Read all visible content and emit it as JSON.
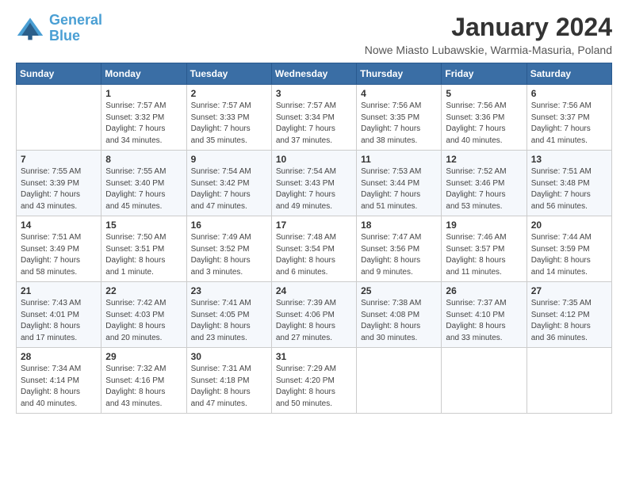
{
  "logo": {
    "line1": "General",
    "line2": "Blue"
  },
  "title": "January 2024",
  "subtitle": "Nowe Miasto Lubawskie, Warmia-Masuria, Poland",
  "days_of_week": [
    "Sunday",
    "Monday",
    "Tuesday",
    "Wednesday",
    "Thursday",
    "Friday",
    "Saturday"
  ],
  "weeks": [
    [
      {
        "day": "",
        "info": ""
      },
      {
        "day": "1",
        "info": "Sunrise: 7:57 AM\nSunset: 3:32 PM\nDaylight: 7 hours\nand 34 minutes."
      },
      {
        "day": "2",
        "info": "Sunrise: 7:57 AM\nSunset: 3:33 PM\nDaylight: 7 hours\nand 35 minutes."
      },
      {
        "day": "3",
        "info": "Sunrise: 7:57 AM\nSunset: 3:34 PM\nDaylight: 7 hours\nand 37 minutes."
      },
      {
        "day": "4",
        "info": "Sunrise: 7:56 AM\nSunset: 3:35 PM\nDaylight: 7 hours\nand 38 minutes."
      },
      {
        "day": "5",
        "info": "Sunrise: 7:56 AM\nSunset: 3:36 PM\nDaylight: 7 hours\nand 40 minutes."
      },
      {
        "day": "6",
        "info": "Sunrise: 7:56 AM\nSunset: 3:37 PM\nDaylight: 7 hours\nand 41 minutes."
      }
    ],
    [
      {
        "day": "7",
        "info": "Sunrise: 7:55 AM\nSunset: 3:39 PM\nDaylight: 7 hours\nand 43 minutes."
      },
      {
        "day": "8",
        "info": "Sunrise: 7:55 AM\nSunset: 3:40 PM\nDaylight: 7 hours\nand 45 minutes."
      },
      {
        "day": "9",
        "info": "Sunrise: 7:54 AM\nSunset: 3:42 PM\nDaylight: 7 hours\nand 47 minutes."
      },
      {
        "day": "10",
        "info": "Sunrise: 7:54 AM\nSunset: 3:43 PM\nDaylight: 7 hours\nand 49 minutes."
      },
      {
        "day": "11",
        "info": "Sunrise: 7:53 AM\nSunset: 3:44 PM\nDaylight: 7 hours\nand 51 minutes."
      },
      {
        "day": "12",
        "info": "Sunrise: 7:52 AM\nSunset: 3:46 PM\nDaylight: 7 hours\nand 53 minutes."
      },
      {
        "day": "13",
        "info": "Sunrise: 7:51 AM\nSunset: 3:48 PM\nDaylight: 7 hours\nand 56 minutes."
      }
    ],
    [
      {
        "day": "14",
        "info": "Sunrise: 7:51 AM\nSunset: 3:49 PM\nDaylight: 7 hours\nand 58 minutes."
      },
      {
        "day": "15",
        "info": "Sunrise: 7:50 AM\nSunset: 3:51 PM\nDaylight: 8 hours\nand 1 minute."
      },
      {
        "day": "16",
        "info": "Sunrise: 7:49 AM\nSunset: 3:52 PM\nDaylight: 8 hours\nand 3 minutes."
      },
      {
        "day": "17",
        "info": "Sunrise: 7:48 AM\nSunset: 3:54 PM\nDaylight: 8 hours\nand 6 minutes."
      },
      {
        "day": "18",
        "info": "Sunrise: 7:47 AM\nSunset: 3:56 PM\nDaylight: 8 hours\nand 9 minutes."
      },
      {
        "day": "19",
        "info": "Sunrise: 7:46 AM\nSunset: 3:57 PM\nDaylight: 8 hours\nand 11 minutes."
      },
      {
        "day": "20",
        "info": "Sunrise: 7:44 AM\nSunset: 3:59 PM\nDaylight: 8 hours\nand 14 minutes."
      }
    ],
    [
      {
        "day": "21",
        "info": "Sunrise: 7:43 AM\nSunset: 4:01 PM\nDaylight: 8 hours\nand 17 minutes."
      },
      {
        "day": "22",
        "info": "Sunrise: 7:42 AM\nSunset: 4:03 PM\nDaylight: 8 hours\nand 20 minutes."
      },
      {
        "day": "23",
        "info": "Sunrise: 7:41 AM\nSunset: 4:05 PM\nDaylight: 8 hours\nand 23 minutes."
      },
      {
        "day": "24",
        "info": "Sunrise: 7:39 AM\nSunset: 4:06 PM\nDaylight: 8 hours\nand 27 minutes."
      },
      {
        "day": "25",
        "info": "Sunrise: 7:38 AM\nSunset: 4:08 PM\nDaylight: 8 hours\nand 30 minutes."
      },
      {
        "day": "26",
        "info": "Sunrise: 7:37 AM\nSunset: 4:10 PM\nDaylight: 8 hours\nand 33 minutes."
      },
      {
        "day": "27",
        "info": "Sunrise: 7:35 AM\nSunset: 4:12 PM\nDaylight: 8 hours\nand 36 minutes."
      }
    ],
    [
      {
        "day": "28",
        "info": "Sunrise: 7:34 AM\nSunset: 4:14 PM\nDaylight: 8 hours\nand 40 minutes."
      },
      {
        "day": "29",
        "info": "Sunrise: 7:32 AM\nSunset: 4:16 PM\nDaylight: 8 hours\nand 43 minutes."
      },
      {
        "day": "30",
        "info": "Sunrise: 7:31 AM\nSunset: 4:18 PM\nDaylight: 8 hours\nand 47 minutes."
      },
      {
        "day": "31",
        "info": "Sunrise: 7:29 AM\nSunset: 4:20 PM\nDaylight: 8 hours\nand 50 minutes."
      },
      {
        "day": "",
        "info": ""
      },
      {
        "day": "",
        "info": ""
      },
      {
        "day": "",
        "info": ""
      }
    ]
  ]
}
